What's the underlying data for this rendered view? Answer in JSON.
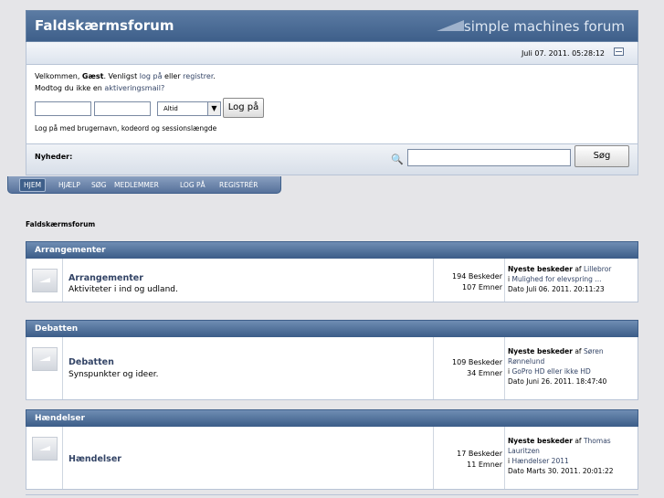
{
  "header": {
    "title": "Faldskærmsforum",
    "logo_text": "simple machines forum"
  },
  "datebar": {
    "datetime": "Juli 07. 2011. 05:28:12"
  },
  "user": {
    "welcome_prefix": "Velkommen, ",
    "guest": "Gæst",
    "welcome_mid": ". Venligst ",
    "login_link": "log på",
    "or": " eller ",
    "register_link": "registrer",
    "end": ".",
    "activation_prefix": "Modtog du ikke en ",
    "activation_link": "aktiveringsmail?",
    "duration_select": "Altid",
    "login_button": "Log på",
    "hint": "Log på med brugernavn, kodeord og sessionslængde"
  },
  "news": {
    "label": "Nyheder:",
    "search_button": "Søg"
  },
  "menu": [
    "HJEM",
    "HJÆLP",
    "SØG",
    "MEDLEMMER",
    "LOG PÅ",
    "REGISTRÉR"
  ],
  "breadcrumb": "Faldskærmsforum",
  "categories": [
    {
      "name": "Arrangementer",
      "board": {
        "name": "Arrangementer",
        "desc": "Aktiviteter i ind og udland.",
        "posts": "194 Beskeder",
        "topics": "107 Emner",
        "last_label": "Nyeste beskeder",
        "by": " af ",
        "author": "Lillebror",
        "in": "i ",
        "topic": "Mulighed for elevspring ...",
        "date": "Dato Juli 06. 2011. 20:11:23"
      }
    },
    {
      "name": "Debatten",
      "board": {
        "name": "Debatten",
        "desc": "Synspunkter og ideer.",
        "posts": "109 Beskeder",
        "topics": "34 Emner",
        "last_label": "Nyeste beskeder",
        "by": " af ",
        "author": "Søren Rønnelund",
        "in": "i ",
        "topic": "GoPro HD eller ikke HD",
        "date": "Dato Juni 26. 2011. 18:47:40"
      }
    },
    {
      "name": "Hændelser",
      "board": {
        "name": "Hændelser",
        "desc": "",
        "posts": "17 Beskeder",
        "topics": "11 Emner",
        "last_label": "Nyeste beskeder",
        "by": " af ",
        "author": "Thomas Lauritzen",
        "in": "i ",
        "topic": "Hændelser 2011",
        "date": "Dato Marts 30. 2011. 20:01:22"
      }
    }
  ]
}
